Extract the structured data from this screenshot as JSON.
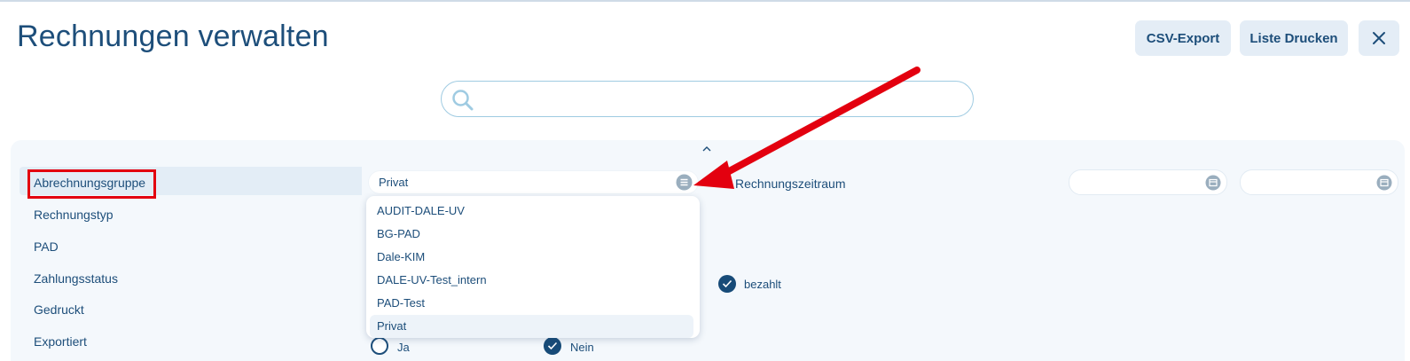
{
  "header": {
    "title": "Rechnungen verwalten",
    "csv_export_label": "CSV-Export",
    "print_list_label": "Liste Drucken",
    "close_icon": "close-icon"
  },
  "search": {
    "placeholder": "",
    "value": "",
    "icon": "search-icon"
  },
  "filters": {
    "collapse_icon": "chevron-up-icon",
    "labels": {
      "billing_group": "Abrechnungsgruppe",
      "invoice_type": "Rechnungstyp",
      "pad": "PAD",
      "payment_status": "Zahlungsstatus",
      "printed": "Gedruckt",
      "exported": "Exportiert",
      "invoice_period": "Rechnungszeitraum"
    },
    "billing_group_select": {
      "selected_value": "Privat",
      "icon": "list-icon",
      "options": [
        "AUDIT-DALE-UV",
        "BG-PAD",
        "Dale-KIM",
        "DALE-UV-Test_intern",
        "PAD-Test",
        "Privat"
      ]
    },
    "invoice_period": {
      "from": "",
      "to": "",
      "icon": "calendar-icon"
    },
    "payment_status_options": [
      {
        "label": "bezahlt",
        "checked": true
      }
    ],
    "exported_options": [
      {
        "label": "Ja",
        "checked": false
      },
      {
        "label": "Nein",
        "checked": true
      }
    ]
  },
  "annotation": {
    "color": "#e3000f"
  }
}
